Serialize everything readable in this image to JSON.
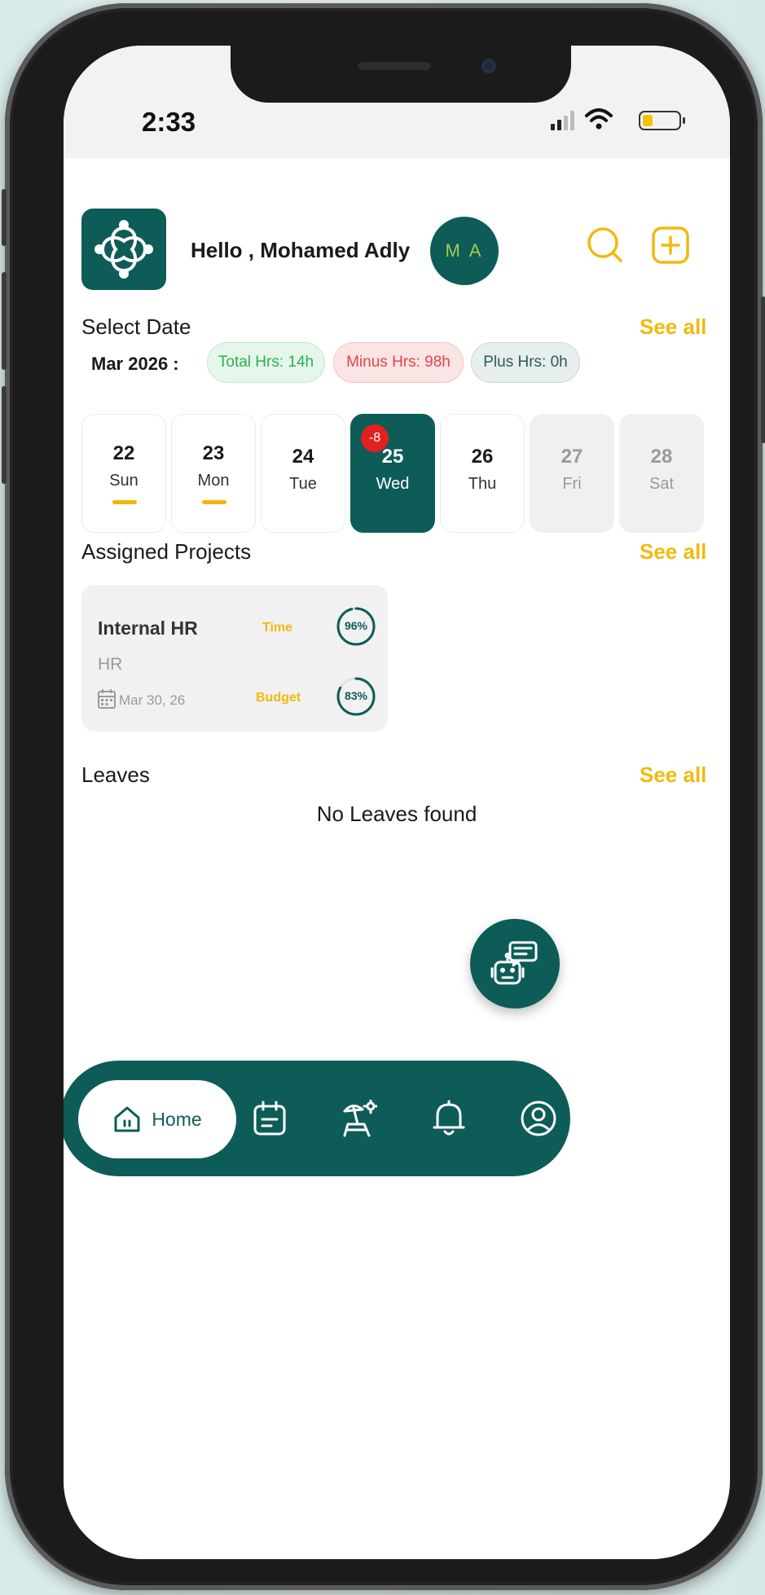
{
  "status_bar": {
    "time": "2:33",
    "battery_level": 0.3
  },
  "header": {
    "greeting": "Hello , Mohamed Adly",
    "avatar_initials": "M A",
    "search_icon": "search-icon",
    "add_icon": "plus-square-icon"
  },
  "select_date": {
    "title": "Select Date",
    "see_all": "See all",
    "month_label": "Mar 2026 :",
    "chips": {
      "total": "Total Hrs: 14h",
      "minus": "Minus Hrs: 98h",
      "plus": "Plus Hrs: 0h"
    },
    "days": [
      {
        "num": "22",
        "name": "Sun",
        "state": "marked"
      },
      {
        "num": "23",
        "name": "Mon",
        "state": "marked"
      },
      {
        "num": "24",
        "name": "Tue",
        "state": "normal"
      },
      {
        "num": "25",
        "name": "Wed",
        "state": "selected",
        "badge": "-8"
      },
      {
        "num": "26",
        "name": "Thu",
        "state": "normal"
      },
      {
        "num": "27",
        "name": "Fri",
        "state": "off"
      },
      {
        "num": "28",
        "name": "Sat",
        "state": "off"
      }
    ]
  },
  "assigned_projects": {
    "title": "Assigned Projects",
    "see_all": "See all",
    "projects": [
      {
        "name": "Internal HR",
        "dept": "HR",
        "date": "Mar 30, 26",
        "time_label": "Time",
        "time_percent": "96%",
        "time_value": 96,
        "budget_label": "Budget",
        "budget_percent": "83%",
        "budget_value": 83
      }
    ]
  },
  "leaves": {
    "title": "Leaves",
    "see_all": "See all",
    "empty_text": "No Leaves found"
  },
  "bottom_nav": {
    "home_label": "Home",
    "items": [
      "home-icon",
      "calendar-note-icon",
      "beach-chair-icon",
      "bell-icon",
      "profile-icon"
    ]
  },
  "colors": {
    "primary": "#0e5c58",
    "accent": "#f2b90f",
    "danger": "#e32020"
  }
}
